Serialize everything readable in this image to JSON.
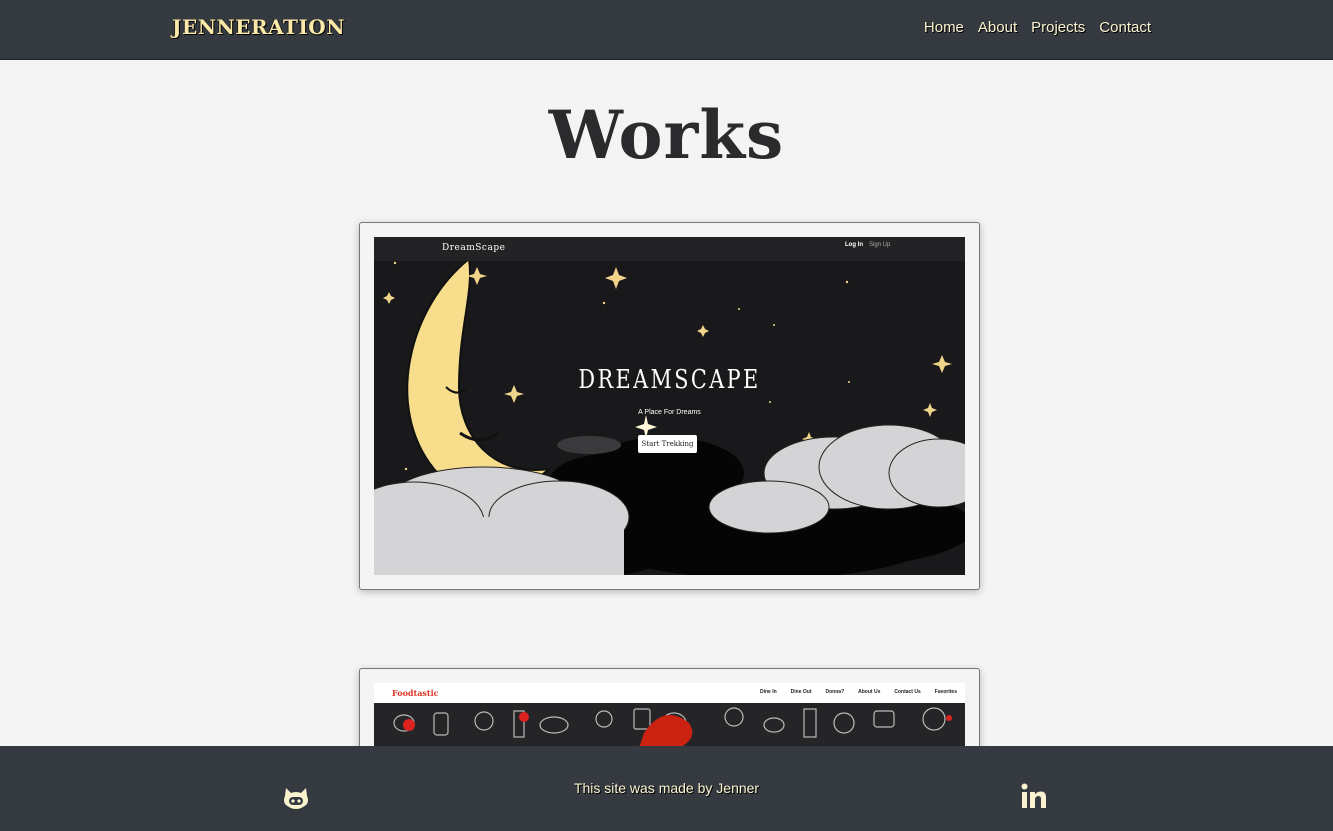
{
  "navbar": {
    "brand": "JENNERATION",
    "links": [
      "Home",
      "About",
      "Projects",
      "Contact"
    ]
  },
  "page": {
    "title": "Works"
  },
  "projects": [
    {
      "name": "Dreamscape",
      "screenshot": {
        "logo": "DreamScape",
        "login": "Log In",
        "signup": "Sign Up",
        "title": "DREAMSCAPE",
        "tagline": "A Place For Dreams",
        "button": "Start Trekking"
      }
    },
    {
      "name": "Foodtastic",
      "screenshot": {
        "logo": "Foodtastic",
        "menu": [
          "Dine In",
          "Dine Out",
          "Donna?",
          "About Us",
          "Contact Us",
          "Favorites"
        ]
      }
    }
  ],
  "footer": {
    "text": "This site was made by Jenner",
    "icons": [
      "github-icon",
      "linkedin-icon"
    ]
  },
  "colors": {
    "navbar_bg": "#343a40",
    "brand": "#fbe9a8",
    "page_bg": "#f4f4f4",
    "moon": "#f7dd8c",
    "star": "#f0d48a"
  }
}
